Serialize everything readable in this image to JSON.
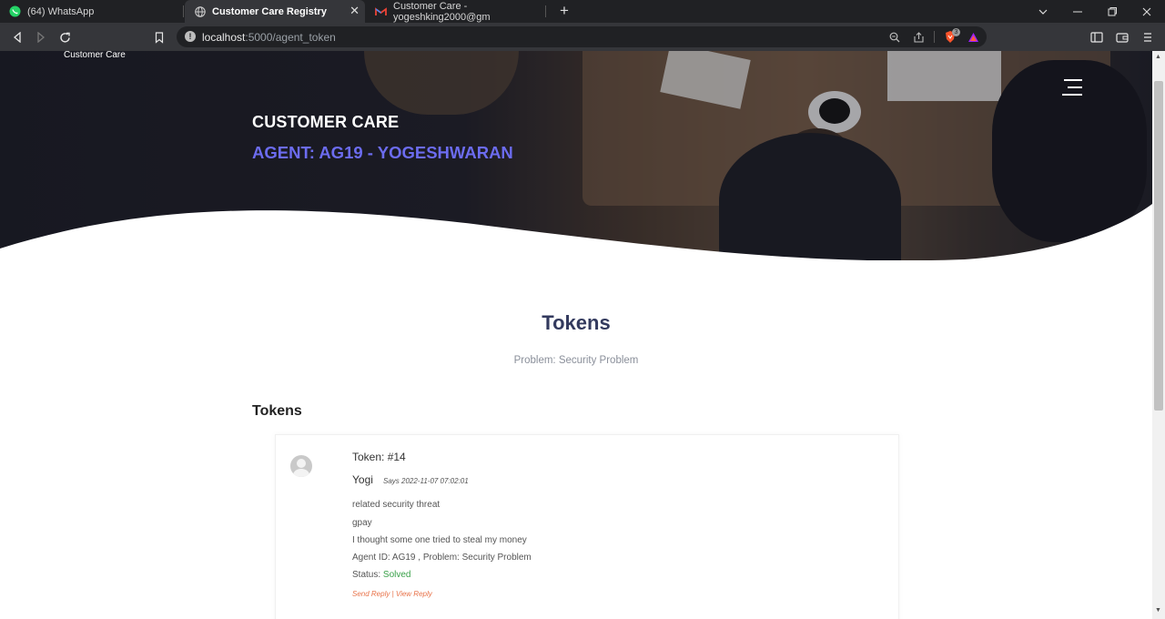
{
  "browser": {
    "tabs": [
      {
        "label": "(64) WhatsApp",
        "icon": "whatsapp-icon"
      },
      {
        "label": "Customer Care Registry",
        "icon": "globe-icon",
        "active": true
      },
      {
        "label": "Customer Care - yogeshking2000@gm",
        "icon": "gmail-icon"
      }
    ],
    "url_host": "localhost",
    "url_path": ":5000/agent_token",
    "brave_badge": "3"
  },
  "hero": {
    "brand": "Customer Care",
    "title": "CUSTOMER CARE",
    "agent": "AGENT: AG19 - YOGESHWARAN"
  },
  "section": {
    "title": "Tokens",
    "subtitle": "Problem: Security Problem",
    "list_heading": "Tokens"
  },
  "token": {
    "number": "Token: #14",
    "user": "Yogi",
    "says": "Says 2022-11-07 07:02:01",
    "lines": [
      "related security threat",
      "gpay",
      "I thought some one tried to steal my money",
      "Agent ID: AG19 , Problem: Security Problem"
    ],
    "status_label": "Status: ",
    "status_value": "Solved",
    "send_reply": "Send Reply",
    "separator": " | ",
    "view_reply": "View Reply"
  },
  "colors": {
    "agent": "#6c6cf0",
    "status_ok": "#3aa14a",
    "reply_links": "#e8734a",
    "section_title": "#333a5e"
  }
}
